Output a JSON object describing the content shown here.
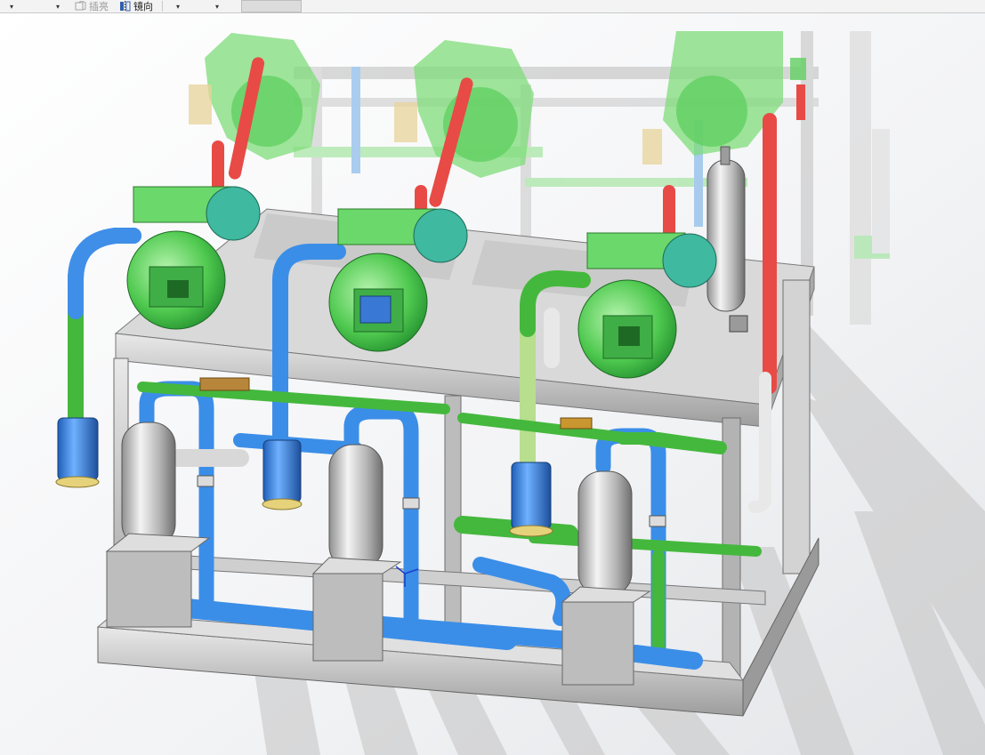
{
  "toolbar": {
    "dropdown_arrow": "▾",
    "insert_label": "插亮",
    "insert_icon": "part-insert-icon",
    "mirror_label": "镜向",
    "mirror_icon": "mirror-icon"
  },
  "colors": {
    "compressor": "#5fd35f",
    "suction_pipe": "#3b8ee8",
    "discharge_pipe": "#e8403c",
    "liquid_pipe": "#44b83d",
    "steel": "#c8c8c8",
    "shadow": "#bdbdbd"
  }
}
